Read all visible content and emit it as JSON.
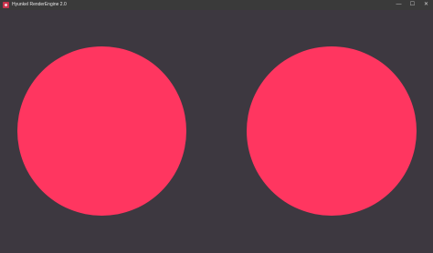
{
  "window": {
    "title": "Hyunkel RenderEngine 2.0",
    "app_icon": "app-logo-icon",
    "controls": {
      "minimize_icon": "minimize-icon",
      "minimize_glyph": "—",
      "maximize_icon": "maximize-icon",
      "maximize_glyph": "☐",
      "close_icon": "close-icon",
      "close_glyph": "✕"
    }
  },
  "scene": {
    "background_color": "#3d3840",
    "circles": [
      {
        "name": "left-circle",
        "color": "#ff3660"
      },
      {
        "name": "right-circle",
        "color": "#ff3660"
      }
    ]
  }
}
